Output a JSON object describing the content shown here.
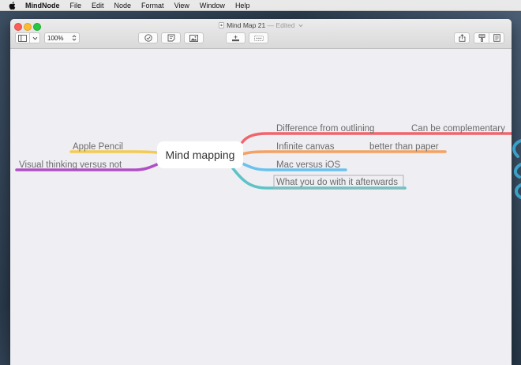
{
  "menubar": {
    "app_name": "MindNode",
    "items": [
      "File",
      "Edit",
      "Node",
      "Format",
      "View",
      "Window",
      "Help"
    ]
  },
  "window": {
    "title": "Mind Map 21",
    "separator": " — ",
    "status": "Edited",
    "zoom": "100%"
  },
  "toolbar_icons": [
    "sidebar-icon",
    "chevron-down-icon",
    "checkmark-circle-icon",
    "note-icon",
    "image-icon",
    "add-child-icon",
    "connect-icon",
    "share-icon",
    "style-icon",
    "outline-icon"
  ],
  "mindmap": {
    "central": "Mind mapping",
    "nodes": [
      {
        "label": "Difference from outlining",
        "color": "#f2636b"
      },
      {
        "label": "Can be complementary",
        "color": "#f2636b"
      },
      {
        "label": "Infinite canvas",
        "color": "#f4a263"
      },
      {
        "label": "better than paper",
        "color": "#f4a263"
      },
      {
        "label": "Mac versus iOS",
        "color": "#69c2ee"
      },
      {
        "label": "What you do with it afterwards",
        "color": "#5cc3c6"
      },
      {
        "label": "Apple Pencil",
        "color": "#f4cb52"
      },
      {
        "label": "Visual thinking versus not",
        "color": "#b04fc5"
      }
    ]
  },
  "colors": {
    "background": "#efeef3",
    "central_node": "#ffffff"
  }
}
